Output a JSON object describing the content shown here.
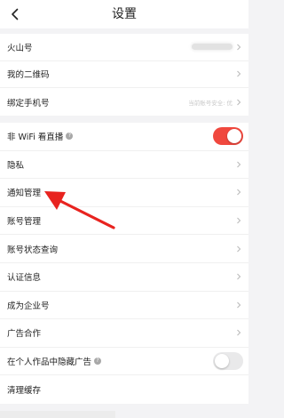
{
  "header": {
    "title": "设置",
    "back_icon": "chevron-left-icon"
  },
  "account_group": [
    {
      "label": "火山号",
      "value_state": "blurred"
    },
    {
      "label": "我的二维码"
    },
    {
      "label": "绑定手机号",
      "right_text": "当前账号安全: 优"
    }
  ],
  "settings_group": [
    {
      "label": "非 WiFi 看直播",
      "help_icon": "?",
      "toggle": true
    },
    {
      "label": "隐私"
    },
    {
      "label": "通知管理"
    },
    {
      "label": "账号管理"
    },
    {
      "label": "账号状态查询"
    },
    {
      "label": "认证信息"
    },
    {
      "label": "成为企业号"
    },
    {
      "label": "广告合作"
    },
    {
      "label": "在个人作品中隐藏广告",
      "help_icon": "?",
      "toggle": false
    },
    {
      "label": "清理缓存"
    }
  ],
  "colors": {
    "accent": "#f0483e",
    "annotation_arrow": "#e8231f"
  }
}
